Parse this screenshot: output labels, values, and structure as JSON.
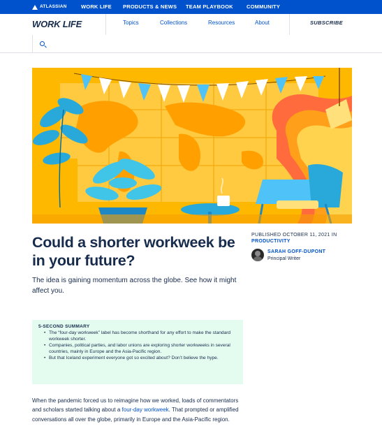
{
  "topbar": {
    "logo": "ATLASSIAN",
    "items": [
      "WORK LIFE",
      "PRODUCTS & NEWS",
      "TEAM PLAYBOOK",
      "COMMUNITY"
    ]
  },
  "header": {
    "brand": "WORK LIFE",
    "nav": [
      "Topics",
      "Collections",
      "Resources",
      "About"
    ],
    "subscribe": "SUBSCRIBE",
    "search_icon": "search-icon"
  },
  "article": {
    "title": "Could a shorter workweek be in your future?",
    "dek": "The idea is gaining momentum across the globe. See how it might affect you.",
    "published": "PUBLISHED OCTOBER 11, 2021 IN",
    "category": "PRODUCTIVITY",
    "author_name": "SARAH GOFF-DUPONT",
    "author_role": "Principal Writer",
    "summary_label": "5-SECOND SUMMARY",
    "summary_items": [
      "The “four-day workweek” label has become shorthand for any effort to make the standard workweek shorter.",
      "Companies, political parties, and labor unions are exploring shorter workweeks in several countries, mainly in Europe and the Asia-Pacific region.",
      "But that Iceland experiment everyone got so excited about? Don’t believe the hype."
    ],
    "body_before_link": "When the pandemic forced us to reimagine how we worked, loads of commentators and scholars started talking about a ",
    "body_link": "four-day workweek",
    "body_after_link": ". That prompted or amplified conversations all over the globe, primarily in Europe and the Asia-Pacific region."
  },
  "colors": {
    "brand_blue": "#0052cc",
    "text_dark": "#172b4d",
    "summary_bg": "#e3fcef",
    "hero_yellow": "#ffc400",
    "hero_orange": "#ff8b00"
  }
}
